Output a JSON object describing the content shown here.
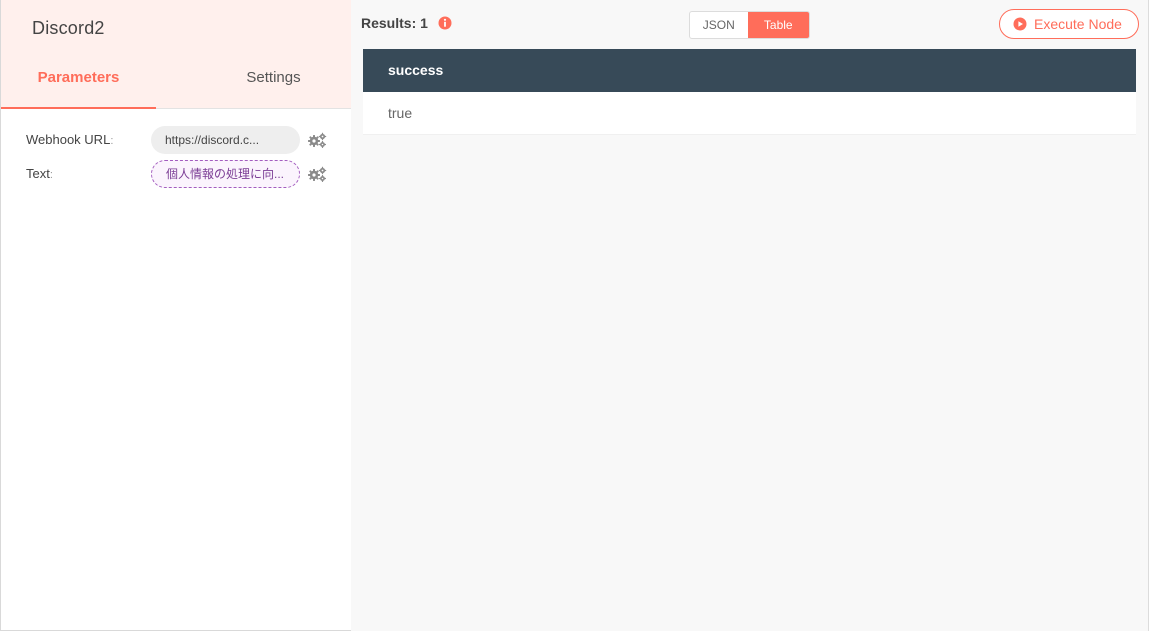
{
  "node": {
    "title": "Discord2"
  },
  "tabs": [
    {
      "label": "Parameters",
      "active": true
    },
    {
      "label": "Settings",
      "active": false
    }
  ],
  "params": [
    {
      "label": "Webhook URL",
      "value": "https://discord.c...",
      "type": "fixed"
    },
    {
      "label": "Text",
      "value": "個人情報の処理に向...",
      "type": "expression"
    }
  ],
  "results": {
    "label": "Results: 1"
  },
  "view_toggle": {
    "json": "JSON",
    "table": "Table",
    "selected": "Table"
  },
  "execute": {
    "label": "Execute Node"
  },
  "table": {
    "headers": [
      "success"
    ],
    "rows": [
      [
        "true"
      ]
    ]
  },
  "icons": {
    "gear": "gears-icon",
    "info": "info-circle-icon",
    "execute": "play-circle-icon"
  },
  "colors": {
    "accent": "#ff6d5a",
    "table_header": "#374a58",
    "expression": "#a35dbf"
  }
}
